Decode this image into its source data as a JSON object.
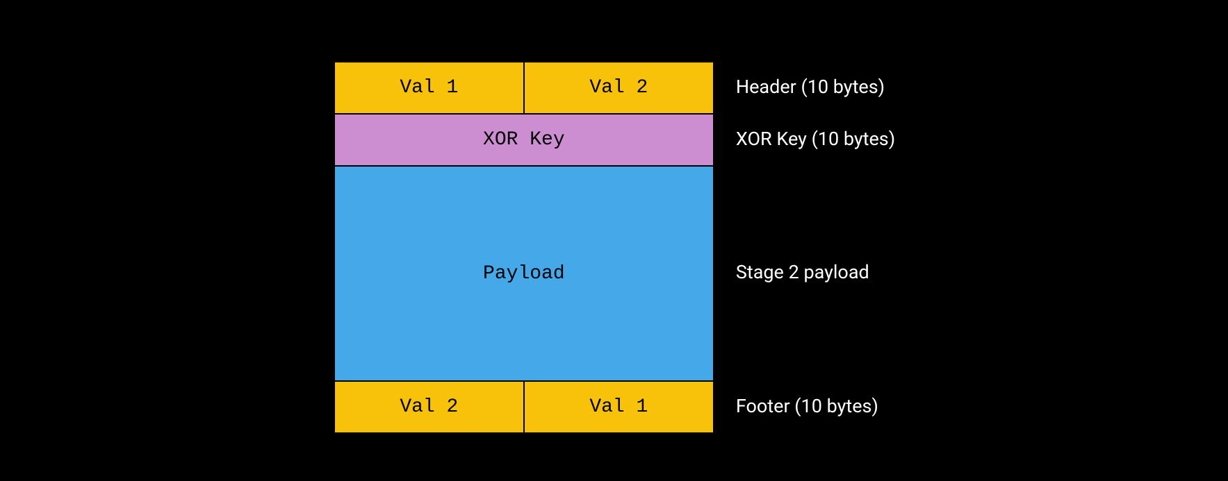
{
  "diagram": {
    "header": {
      "left": "Val 1",
      "right": "Val 2"
    },
    "xor": "XOR Key",
    "payload": "Payload",
    "footer": {
      "left": "Val 2",
      "right": "Val 1"
    }
  },
  "labels": {
    "header": "Header (10 bytes)",
    "xor": "XOR Key (10 bytes)",
    "payload": "Stage 2 payload",
    "footer": "Footer  (10 bytes)"
  }
}
